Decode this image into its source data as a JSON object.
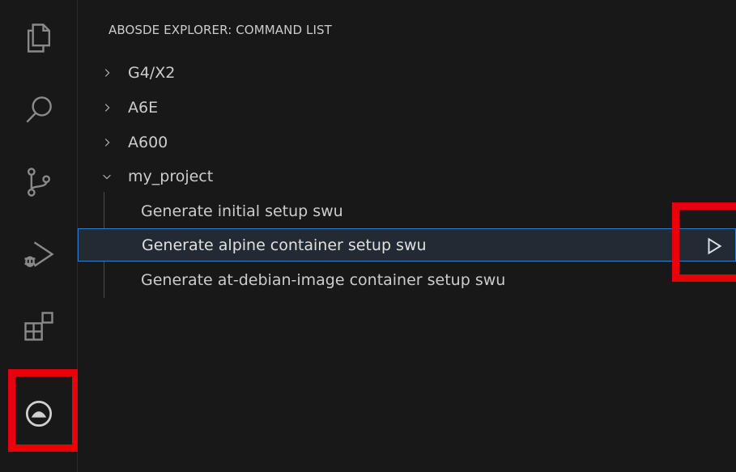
{
  "panel": {
    "title": "ABOSDE EXPLORER: COMMAND LIST"
  },
  "activity_bar": {
    "items": [
      "explorer-icon",
      "search-icon",
      "source-control-icon",
      "run-debug-icon",
      "extensions-icon",
      "abosde-icon"
    ]
  },
  "tree": {
    "groups": [
      {
        "label": "G4/X2",
        "expanded": false
      },
      {
        "label": "A6E",
        "expanded": false
      },
      {
        "label": "A600",
        "expanded": false
      },
      {
        "label": "my_project",
        "expanded": true
      }
    ],
    "children": [
      {
        "label": "Generate initial setup swu"
      },
      {
        "label": "Generate alpine container setup swu",
        "selected": true
      },
      {
        "label": "Generate at-debian-image container setup swu"
      }
    ]
  },
  "colors": {
    "highlight": "#e8000b",
    "selection_border": "#2f7bd6",
    "background": "#181818"
  }
}
